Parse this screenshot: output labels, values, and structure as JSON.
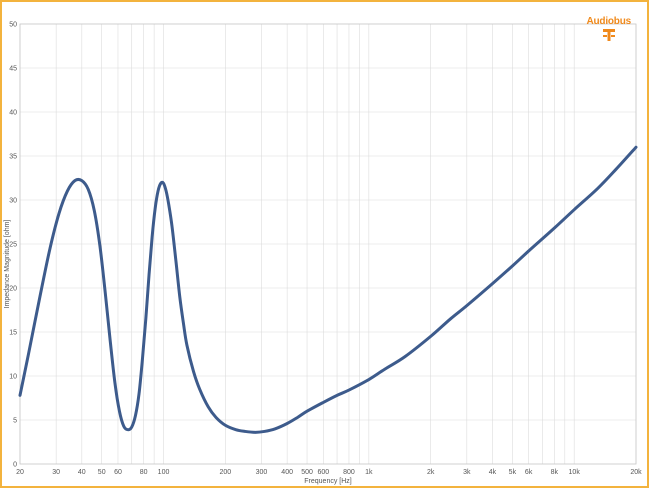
{
  "logo": {
    "text": "Audiobus"
  },
  "colors": {
    "curve": "#3d5b8c",
    "grid": "#dcdcdc",
    "frame": "#f3b33d",
    "logo": "#f08a1c"
  },
  "chart_data": {
    "type": "line",
    "title": "",
    "xlabel": "Frequency [Hz]",
    "ylabel": "Impedance Magnitude [ohm]",
    "xscale": "log",
    "xlim": [
      20,
      20000
    ],
    "ylim": [
      0,
      50
    ],
    "grid": true,
    "x_ticks": [
      20,
      30,
      40,
      50,
      60,
      80,
      100,
      200,
      300,
      400,
      500,
      600,
      800,
      1000,
      2000,
      3000,
      4000,
      5000,
      6000,
      8000,
      10000,
      20000
    ],
    "x_tick_labels": [
      "20",
      "30",
      "40",
      "50",
      "60",
      "80",
      "100",
      "200",
      "300",
      "400",
      "500",
      "600",
      "800",
      "1k",
      "2k",
      "3k",
      "4k",
      "5k",
      "6k",
      "8k",
      "10k",
      "20k"
    ],
    "y_ticks": [
      0,
      5,
      10,
      15,
      20,
      25,
      30,
      35,
      40,
      45,
      50
    ],
    "y_tick_labels": [
      "0",
      "5",
      "10",
      "15",
      "20",
      "25",
      "30",
      "35",
      "40",
      "45",
      "50"
    ],
    "series": [
      {
        "x": [
          20,
          22,
          25,
          28,
          31,
          34,
          37,
          40,
          43,
          46,
          49,
          52,
          55,
          58,
          61,
          64,
          67,
          70,
          73,
          76,
          79,
          82,
          85,
          88,
          91,
          94,
          97,
          100,
          103,
          106,
          110,
          115,
          120,
          125,
          130,
          140,
          150,
          165,
          180,
          200,
          225,
          250,
          280,
          310,
          350,
          400,
          450,
          500,
          600,
          700,
          800,
          1000,
          1200,
          1500,
          2000,
          2500,
          3000,
          4000,
          5000,
          6000,
          8000,
          10000,
          13000,
          16000,
          20000
        ],
        "y": [
          7.8,
          12.5,
          19.0,
          24.5,
          28.5,
          31.0,
          32.2,
          32.2,
          31.2,
          28.8,
          24.8,
          19.5,
          14.0,
          9.2,
          6.0,
          4.3,
          3.9,
          4.2,
          5.5,
          8.0,
          12.0,
          16.5,
          21.5,
          25.8,
          29.0,
          31.0,
          31.9,
          31.9,
          31.0,
          29.5,
          27.0,
          23.0,
          19.0,
          16.0,
          13.5,
          10.5,
          8.5,
          6.5,
          5.3,
          4.4,
          3.9,
          3.7,
          3.6,
          3.7,
          4.0,
          4.6,
          5.3,
          6.0,
          7.0,
          7.8,
          8.4,
          9.6,
          10.8,
          12.2,
          14.5,
          16.5,
          18.0,
          20.5,
          22.5,
          24.2,
          26.8,
          28.9,
          31.3,
          33.5,
          36.0
        ]
      }
    ]
  }
}
